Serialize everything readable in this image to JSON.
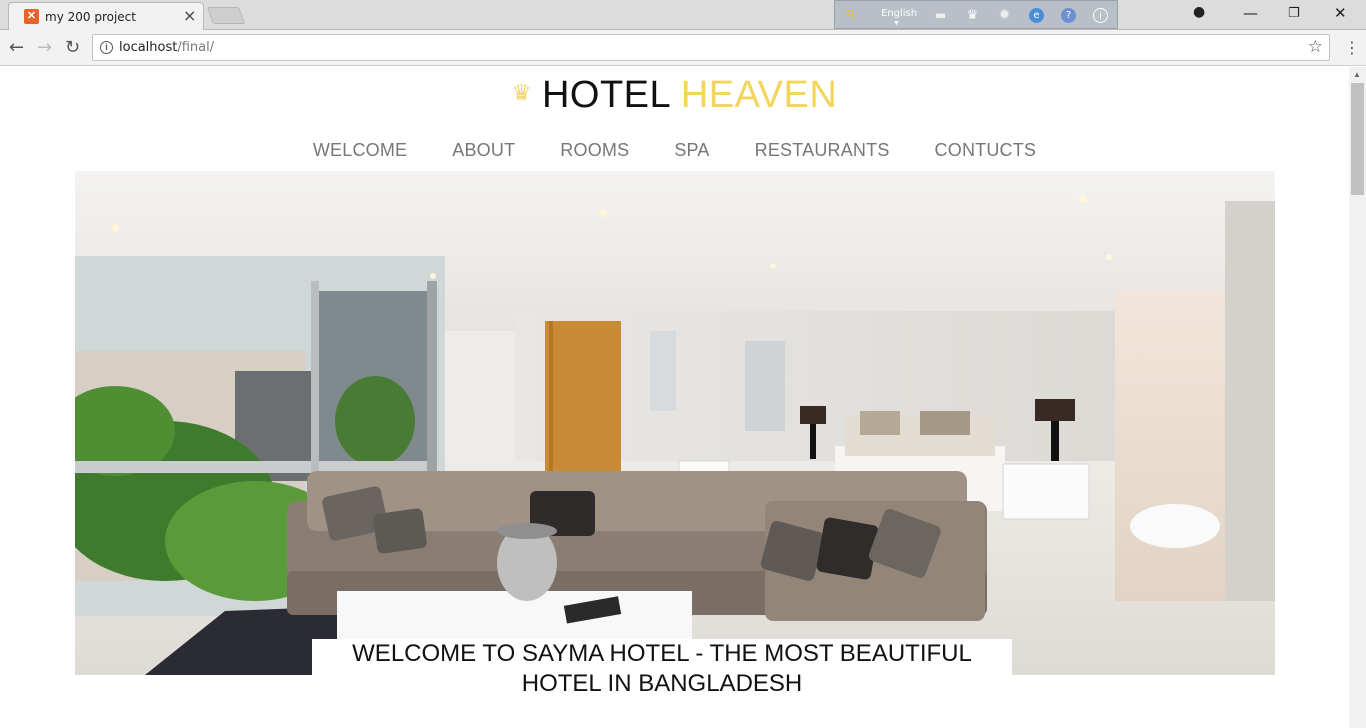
{
  "browser": {
    "tab_title": "my 200 project",
    "url_host": "localhost",
    "url_path": "/final/",
    "extension_language": "English"
  },
  "brand": {
    "word1": "HOTEL",
    "word2": "HEAVEN"
  },
  "nav": {
    "items": [
      {
        "label": "WELCOME"
      },
      {
        "label": "ABOUT"
      },
      {
        "label": "ROOMS"
      },
      {
        "label": "SPA"
      },
      {
        "label": "RESTAURANTS"
      },
      {
        "label": "CONTUCTS"
      }
    ]
  },
  "hero": {
    "caption": "WELCOME TO SAYMA HOTEL - THE MOST BEAUTIFUL HOTEL IN BANGLADESH"
  },
  "colors": {
    "accent": "#f2d55a",
    "nav_text": "#777777"
  }
}
